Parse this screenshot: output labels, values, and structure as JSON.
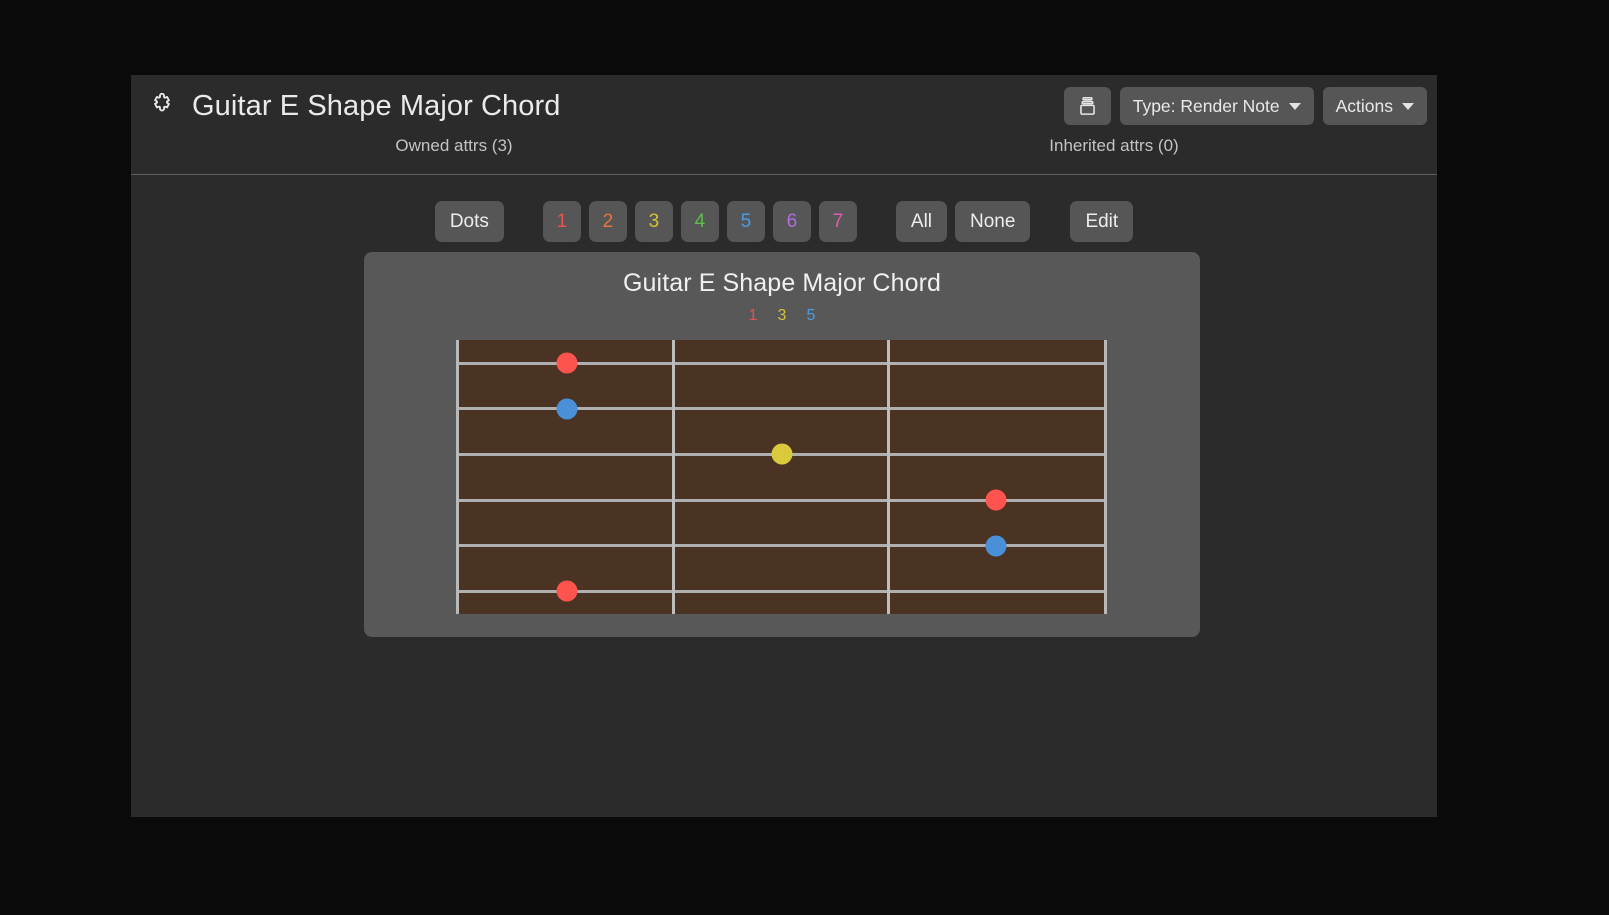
{
  "header": {
    "icon": "puzzle-piece-icon",
    "title": "Guitar E Shape Major Chord",
    "archive_button_icon": "archive-box-icon",
    "type_button_label": "Type: Render Note",
    "actions_button_label": "Actions"
  },
  "attrs": {
    "owned": "Owned attrs (3)",
    "inherited": "Inherited attrs (0)"
  },
  "toolbar": {
    "dots_label": "Dots",
    "numbers": [
      {
        "label": "1",
        "color": "#e8524f"
      },
      {
        "label": "2",
        "color": "#e8733a"
      },
      {
        "label": "3",
        "color": "#d3c33a"
      },
      {
        "label": "4",
        "color": "#5cc04a"
      },
      {
        "label": "5",
        "color": "#4a9de0"
      },
      {
        "label": "6",
        "color": "#b06ede"
      },
      {
        "label": "7",
        "color": "#e05bb0"
      }
    ],
    "all_label": "All",
    "none_label": "None",
    "edit_label": "Edit"
  },
  "card": {
    "title": "Guitar E Shape Major Chord",
    "legend": [
      {
        "label": "1",
        "color": "#e8524f"
      },
      {
        "label": "3",
        "color": "#d3c33a"
      },
      {
        "label": "5",
        "color": "#4a9de0"
      }
    ]
  },
  "chart_data": {
    "type": "diagram",
    "title": "Guitar E Shape Major Chord",
    "subtitle": "1 3 5",
    "board": {
      "strings": 6,
      "frets": 3,
      "board_color": "#4a3322",
      "line_color": "#b0b0b0"
    },
    "string_y_pct": [
      8.5,
      25.0,
      41.7,
      58.4,
      75.0,
      91.7
    ],
    "fret_x_pct": [
      0,
      33.3,
      66.6,
      100
    ],
    "dots": [
      {
        "string": 1,
        "fret": 1,
        "degree": "1",
        "color": "#ff5350",
        "x_pct": 16.8,
        "y_pct": 8.5
      },
      {
        "string": 2,
        "fret": 1,
        "degree": "5",
        "color": "#4a90d9",
        "x_pct": 16.8,
        "y_pct": 25.0
      },
      {
        "string": 3,
        "fret": 2,
        "degree": "3",
        "color": "#d9c93c",
        "x_pct": 50.0,
        "y_pct": 41.7
      },
      {
        "string": 4,
        "fret": 3,
        "degree": "1",
        "color": "#ff5350",
        "x_pct": 83.2,
        "y_pct": 58.4
      },
      {
        "string": 5,
        "fret": 3,
        "degree": "5",
        "color": "#4a90d9",
        "x_pct": 83.2,
        "y_pct": 75.0
      },
      {
        "string": 6,
        "fret": 1,
        "degree": "1",
        "color": "#ff5350",
        "x_pct": 16.8,
        "y_pct": 91.7
      }
    ]
  }
}
